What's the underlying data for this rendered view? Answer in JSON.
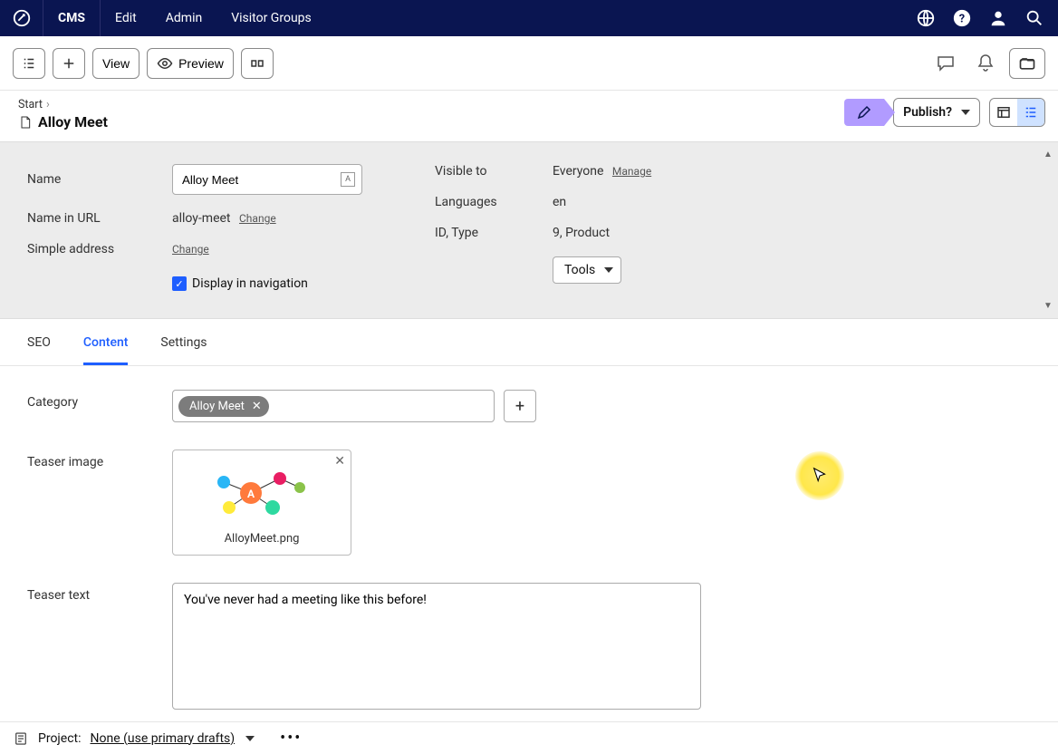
{
  "nav": {
    "items": [
      "CMS",
      "Edit",
      "Admin",
      "Visitor Groups"
    ]
  },
  "toolbar": {
    "view": "View",
    "preview": "Preview"
  },
  "breadcrumb": {
    "root": "Start"
  },
  "page": {
    "title": "Alloy Meet"
  },
  "status": {
    "publish": "Publish?"
  },
  "props": {
    "labels": {
      "name": "Name",
      "nameInUrl": "Name in URL",
      "simpleAddress": "Simple address",
      "displayInNav": "Display in navigation",
      "visibleTo": "Visible to",
      "languages": "Languages",
      "idType": "ID, Type"
    },
    "name": "Alloy Meet",
    "nameInUrl": "alloy-meet",
    "changeLabel": "Change",
    "displayInNavChecked": true,
    "visibleTo": "Everyone",
    "manageLabel": "Manage",
    "languages": "en",
    "idType": "9, Product",
    "toolsLabel": "Tools"
  },
  "tabs": [
    "SEO",
    "Content",
    "Settings"
  ],
  "activeTab": 1,
  "content": {
    "categoryLabel": "Category",
    "categoryTags": [
      "Alloy Meet"
    ],
    "teaserImageLabel": "Teaser image",
    "teaserImageName": "AlloyMeet.png",
    "teaserTextLabel": "Teaser text",
    "teaserText": "You've never had a meeting like this before!"
  },
  "footer": {
    "projectLabel": "Project:",
    "projectValue": "None (use primary drafts)"
  }
}
